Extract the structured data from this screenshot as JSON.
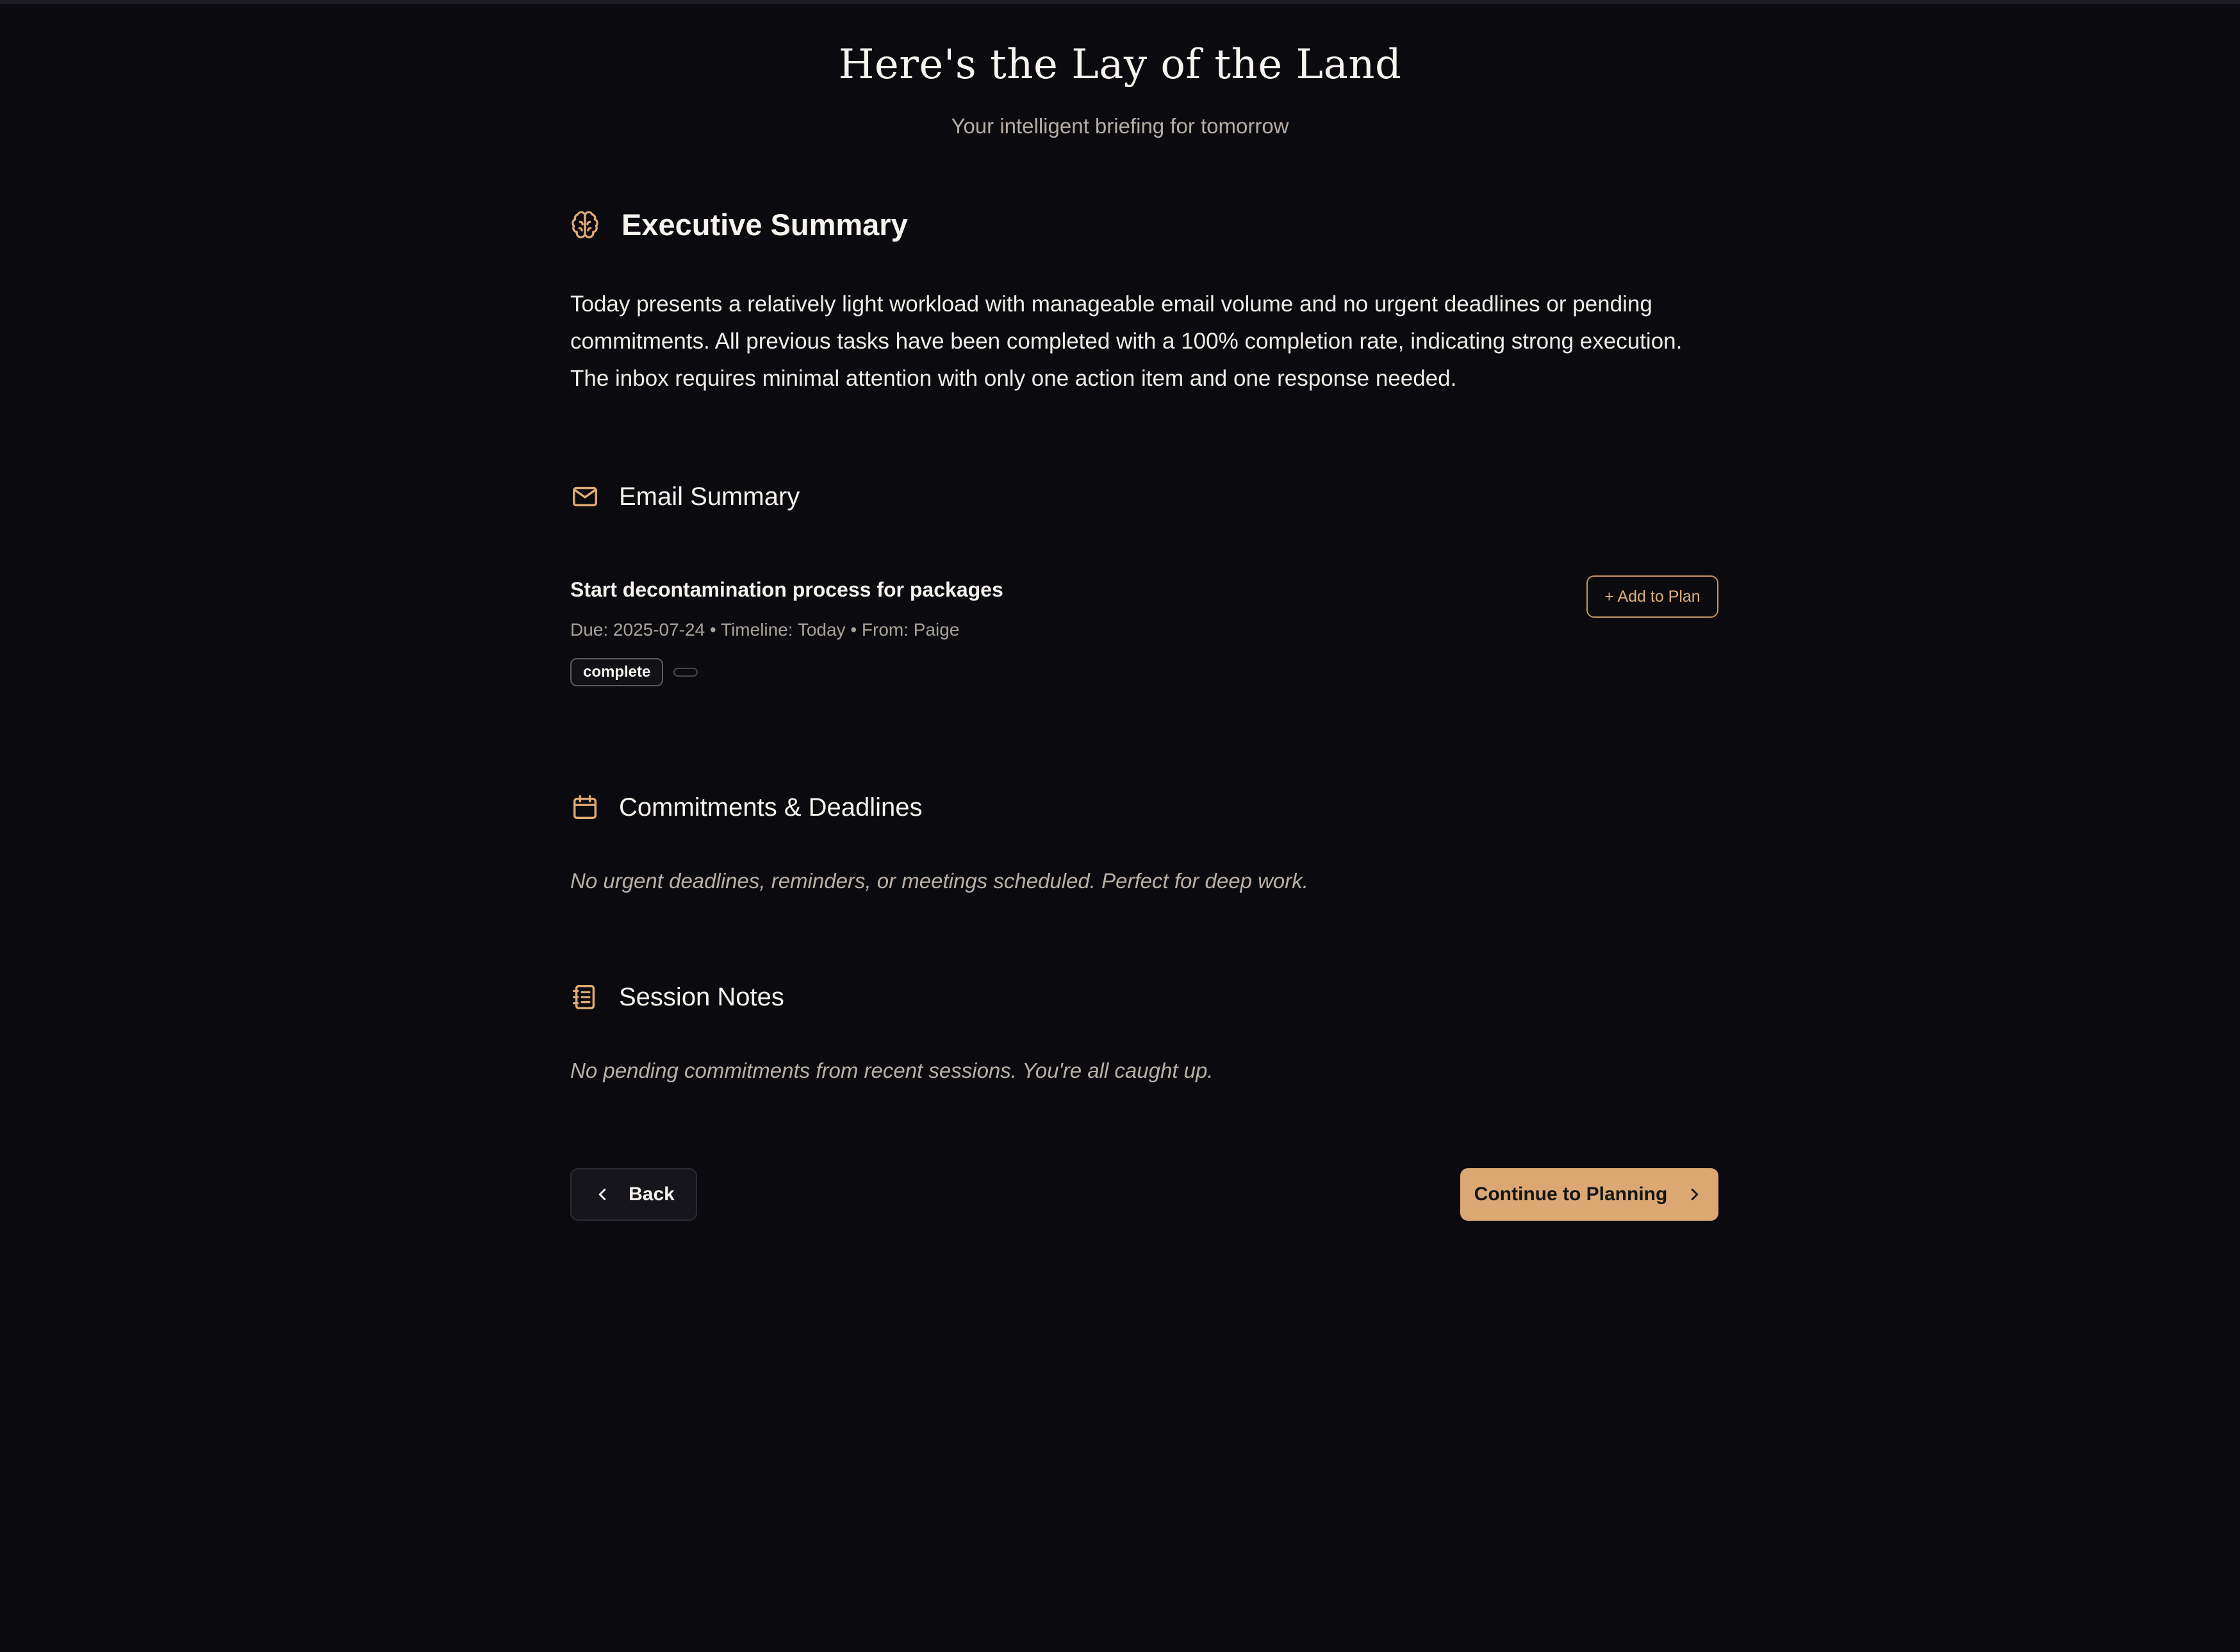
{
  "header": {
    "title": "Here's the Lay of the Land",
    "subtitle": "Your intelligent briefing for tomorrow"
  },
  "sections": {
    "executive": {
      "icon": "brain-icon",
      "title": "Executive Summary",
      "text": "Today presents a relatively light workload with manageable email volume and no urgent deadlines or pending commitments. All previous tasks have been completed with a 100% completion rate, indicating strong execution. The inbox requires minimal attention with only one action item and one response needed."
    },
    "email": {
      "icon": "mail-icon",
      "title": "Email Summary",
      "items": [
        {
          "title": "Start decontamination process for packages",
          "meta": "Due: 2025-07-24 • Timeline: Today • From: Paige",
          "badge": "complete",
          "action_label": "+ Add to Plan"
        }
      ]
    },
    "commitments": {
      "icon": "calendar-icon",
      "title": "Commitments & Deadlines",
      "note": "No urgent deadlines, reminders, or meetings scheduled. Perfect for deep work."
    },
    "session_notes": {
      "icon": "notebook-icon",
      "title": "Session Notes",
      "note": "No pending commitments from recent sessions. You're all caught up."
    }
  },
  "nav": {
    "back_label": "Back",
    "continue_label": "Continue to Planning"
  },
  "colors": {
    "background": "#0b0b0f",
    "accent": "#dba772",
    "icon_accent": "#e0aa74"
  }
}
